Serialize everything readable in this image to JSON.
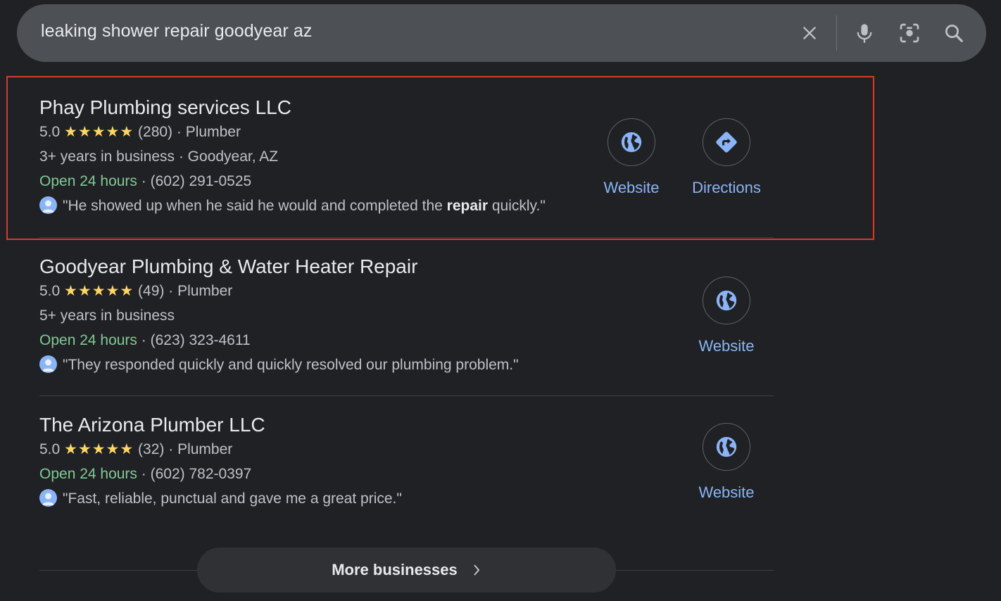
{
  "search": {
    "query": "leaking shower repair goodyear az",
    "icons": [
      "close-icon",
      "mic-icon",
      "camera-lens-icon",
      "search-icon"
    ]
  },
  "results": [
    {
      "title": "Phay Plumbing services LLC",
      "rating": "5.0",
      "stars": "★★★★★",
      "reviews": "(280)",
      "category": "Plumber",
      "info_line": "3+ years in business · Goodyear, AZ",
      "hours": "Open 24 hours",
      "phone": "(602) 291-0525",
      "review_before": "\"He showed up when he said he would and completed the ",
      "review_bold": "repair",
      "review_after": " quickly.\"",
      "website_label": "Website",
      "directions_label": "Directions"
    },
    {
      "title": "Goodyear Plumbing & Water Heater Repair",
      "rating": "5.0",
      "stars": "★★★★★",
      "reviews": "(49)",
      "category": "Plumber",
      "info_line": "5+ years in business",
      "hours": "Open 24 hours",
      "phone": "(623) 323-4611",
      "review": "\"They responded quickly and quickly resolved our plumbing problem.\"",
      "website_label": "Website"
    },
    {
      "title": "The Arizona Plumber LLC",
      "rating": "5.0",
      "stars": "★★★★★",
      "reviews": "(32)",
      "category": "Plumber",
      "hours": "Open 24 hours",
      "phone": "(602) 782-0397",
      "review": "\"Fast, reliable, punctual and gave me a great price.\"",
      "website_label": "Website"
    }
  ],
  "more": {
    "label": "More businesses"
  },
  "colors": {
    "background": "#202124",
    "link": "#8ab4f8",
    "open": "#81c995",
    "stars": "#fdd663",
    "highlight": "#d93a2b"
  }
}
